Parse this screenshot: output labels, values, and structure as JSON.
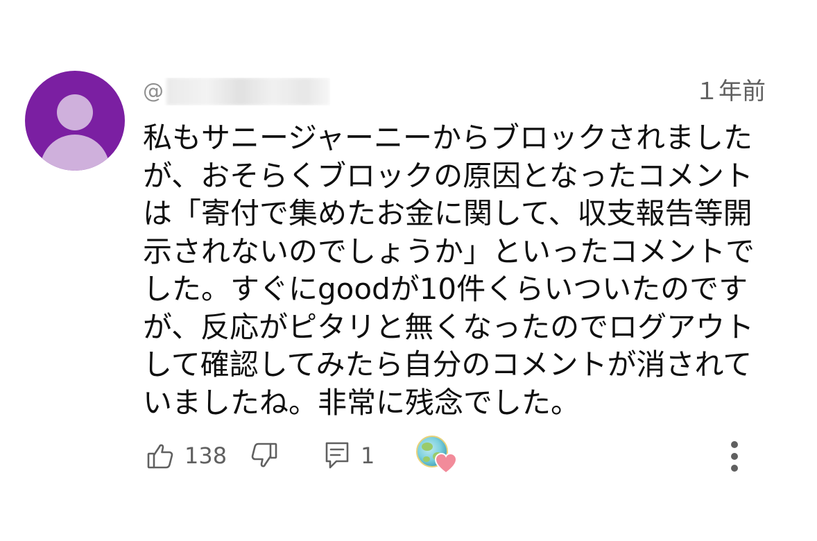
{
  "comment": {
    "author_prefix": "@",
    "timestamp": "１年前",
    "body_lines": [
      "私もサニージャーニーからブロックされました",
      "が、おそらくブロックの原因となったコメント",
      "は「寄付で集めたお金に関して、収支報告等開",
      "示されないのでしょうか」といったコメントで",
      "した。すぐにgoodが10件くらいついたのです",
      "が、反応がピタリと無くなったのでログアウト",
      "して確認してみたら自分のコメントが消されて",
      "いましたね。非常に残念でした。"
    ],
    "like_count": "138",
    "reply_count": "1"
  },
  "colors": {
    "avatar_bg": "#7b1fa2",
    "avatar_fg": "#cfb0dc",
    "secondary_text": "#606060",
    "heart": "#f28b9a"
  },
  "icons": {
    "like": "thumbs-up-icon",
    "dislike": "thumbs-down-icon",
    "reply": "reply-comment-icon",
    "creator_heart": "creator-heart-icon",
    "more": "more-vertical-icon"
  }
}
